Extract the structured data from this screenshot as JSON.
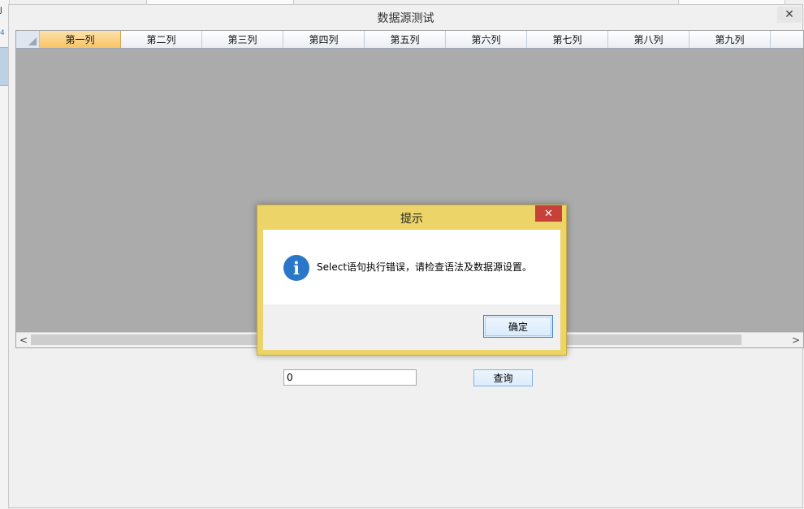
{
  "background": {
    "left_fragment_1": "J",
    "left_fragment_2": "4"
  },
  "window": {
    "title": "数据源测试",
    "close_icon": "close-icon"
  },
  "grid": {
    "columns": [
      "第一列",
      "第二列",
      "第三列",
      "第四列",
      "第五列",
      "第六列",
      "第七列",
      "第八列",
      "第九列",
      "第"
    ],
    "selected_column_index": 0,
    "scroll_left_icon": "chevron-left-icon",
    "scroll_right_icon": "chevron-right-icon"
  },
  "query": {
    "input_value": "0",
    "button_label": "查询"
  },
  "dialog": {
    "title": "提示",
    "close_icon": "close-icon",
    "icon": "info-icon",
    "message": "Select语句执行错误，请检查语法及数据源设置。",
    "ok_label": "确定"
  },
  "colors": {
    "dialog_frame": "#ecd468",
    "dialog_close": "#c7403a",
    "info_icon": "#2a76c9",
    "grid_body": "#ababab",
    "selected_header": "#f7c465"
  }
}
